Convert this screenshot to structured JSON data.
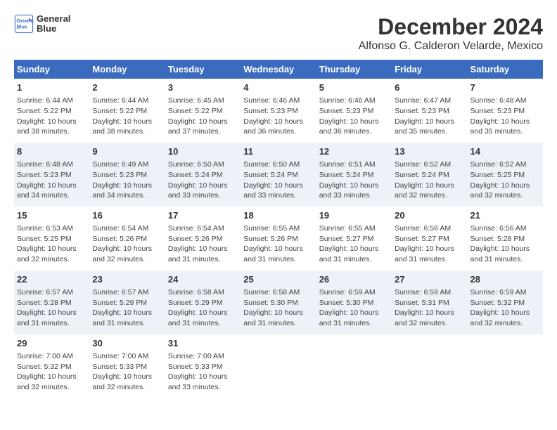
{
  "logo": {
    "line1": "General",
    "line2": "Blue"
  },
  "title": "December 2024",
  "subtitle": "Alfonso G. Calderon Velarde, Mexico",
  "days_header": [
    "Sunday",
    "Monday",
    "Tuesday",
    "Wednesday",
    "Thursday",
    "Friday",
    "Saturday"
  ],
  "weeks": [
    [
      {
        "day": "1",
        "info": "Sunrise: 6:44 AM\nSunset: 5:22 PM\nDaylight: 10 hours\nand 38 minutes."
      },
      {
        "day": "2",
        "info": "Sunrise: 6:44 AM\nSunset: 5:22 PM\nDaylight: 10 hours\nand 38 minutes."
      },
      {
        "day": "3",
        "info": "Sunrise: 6:45 AM\nSunset: 5:22 PM\nDaylight: 10 hours\nand 37 minutes."
      },
      {
        "day": "4",
        "info": "Sunrise: 6:46 AM\nSunset: 5:23 PM\nDaylight: 10 hours\nand 36 minutes."
      },
      {
        "day": "5",
        "info": "Sunrise: 6:46 AM\nSunset: 5:23 PM\nDaylight: 10 hours\nand 36 minutes."
      },
      {
        "day": "6",
        "info": "Sunrise: 6:47 AM\nSunset: 5:23 PM\nDaylight: 10 hours\nand 35 minutes."
      },
      {
        "day": "7",
        "info": "Sunrise: 6:48 AM\nSunset: 5:23 PM\nDaylight: 10 hours\nand 35 minutes."
      }
    ],
    [
      {
        "day": "8",
        "info": "Sunrise: 6:48 AM\nSunset: 5:23 PM\nDaylight: 10 hours\nand 34 minutes."
      },
      {
        "day": "9",
        "info": "Sunrise: 6:49 AM\nSunset: 5:23 PM\nDaylight: 10 hours\nand 34 minutes."
      },
      {
        "day": "10",
        "info": "Sunrise: 6:50 AM\nSunset: 5:24 PM\nDaylight: 10 hours\nand 33 minutes."
      },
      {
        "day": "11",
        "info": "Sunrise: 6:50 AM\nSunset: 5:24 PM\nDaylight: 10 hours\nand 33 minutes."
      },
      {
        "day": "12",
        "info": "Sunrise: 6:51 AM\nSunset: 5:24 PM\nDaylight: 10 hours\nand 33 minutes."
      },
      {
        "day": "13",
        "info": "Sunrise: 6:52 AM\nSunset: 5:24 PM\nDaylight: 10 hours\nand 32 minutes."
      },
      {
        "day": "14",
        "info": "Sunrise: 6:52 AM\nSunset: 5:25 PM\nDaylight: 10 hours\nand 32 minutes."
      }
    ],
    [
      {
        "day": "15",
        "info": "Sunrise: 6:53 AM\nSunset: 5:25 PM\nDaylight: 10 hours\nand 32 minutes."
      },
      {
        "day": "16",
        "info": "Sunrise: 6:54 AM\nSunset: 5:26 PM\nDaylight: 10 hours\nand 32 minutes."
      },
      {
        "day": "17",
        "info": "Sunrise: 6:54 AM\nSunset: 5:26 PM\nDaylight: 10 hours\nand 31 minutes."
      },
      {
        "day": "18",
        "info": "Sunrise: 6:55 AM\nSunset: 5:26 PM\nDaylight: 10 hours\nand 31 minutes."
      },
      {
        "day": "19",
        "info": "Sunrise: 6:55 AM\nSunset: 5:27 PM\nDaylight: 10 hours\nand 31 minutes."
      },
      {
        "day": "20",
        "info": "Sunrise: 6:56 AM\nSunset: 5:27 PM\nDaylight: 10 hours\nand 31 minutes."
      },
      {
        "day": "21",
        "info": "Sunrise: 6:56 AM\nSunset: 5:28 PM\nDaylight: 10 hours\nand 31 minutes."
      }
    ],
    [
      {
        "day": "22",
        "info": "Sunrise: 6:57 AM\nSunset: 5:28 PM\nDaylight: 10 hours\nand 31 minutes."
      },
      {
        "day": "23",
        "info": "Sunrise: 6:57 AM\nSunset: 5:29 PM\nDaylight: 10 hours\nand 31 minutes."
      },
      {
        "day": "24",
        "info": "Sunrise: 6:58 AM\nSunset: 5:29 PM\nDaylight: 10 hours\nand 31 minutes."
      },
      {
        "day": "25",
        "info": "Sunrise: 6:58 AM\nSunset: 5:30 PM\nDaylight: 10 hours\nand 31 minutes."
      },
      {
        "day": "26",
        "info": "Sunrise: 6:59 AM\nSunset: 5:30 PM\nDaylight: 10 hours\nand 31 minutes."
      },
      {
        "day": "27",
        "info": "Sunrise: 6:59 AM\nSunset: 5:31 PM\nDaylight: 10 hours\nand 32 minutes."
      },
      {
        "day": "28",
        "info": "Sunrise: 6:59 AM\nSunset: 5:32 PM\nDaylight: 10 hours\nand 32 minutes."
      }
    ],
    [
      {
        "day": "29",
        "info": "Sunrise: 7:00 AM\nSunset: 5:32 PM\nDaylight: 10 hours\nand 32 minutes."
      },
      {
        "day": "30",
        "info": "Sunrise: 7:00 AM\nSunset: 5:33 PM\nDaylight: 10 hours\nand 32 minutes."
      },
      {
        "day": "31",
        "info": "Sunrise: 7:00 AM\nSunset: 5:33 PM\nDaylight: 10 hours\nand 33 minutes."
      },
      {
        "day": "",
        "info": ""
      },
      {
        "day": "",
        "info": ""
      },
      {
        "day": "",
        "info": ""
      },
      {
        "day": "",
        "info": ""
      }
    ]
  ]
}
